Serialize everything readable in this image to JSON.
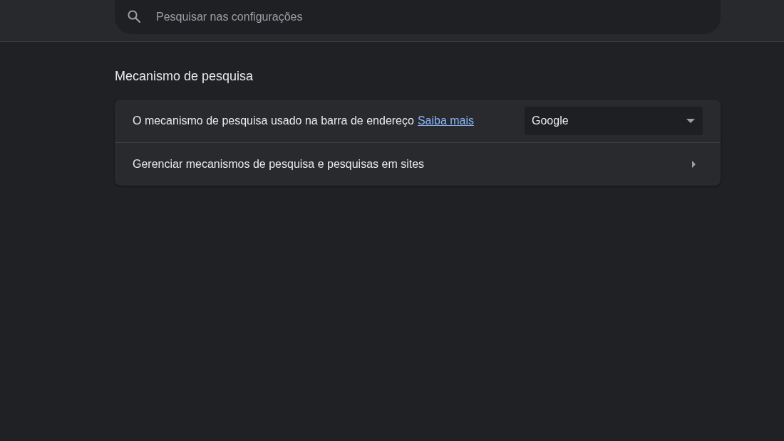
{
  "search": {
    "placeholder": "Pesquisar nas configurações"
  },
  "section": {
    "title": "Mecanismo de pesquisa",
    "rows": [
      {
        "kind": "select",
        "label": "O mecanismo de pesquisa usado na barra de endereço",
        "link": "Saiba mais",
        "value": "Google"
      },
      {
        "kind": "link-row",
        "label": "Gerenciar mecanismos de pesquisa e pesquisas em sites"
      }
    ]
  }
}
